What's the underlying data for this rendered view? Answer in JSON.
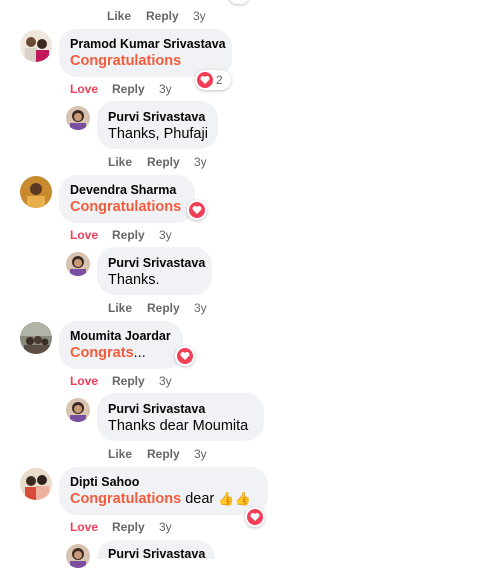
{
  "actions": {
    "like": "Like",
    "love": "Love",
    "reply": "Reply",
    "age": "3y"
  },
  "comments": [
    {
      "author": "Pramod Kumar Srivastava",
      "text": "Congratulations",
      "reaction": "heart",
      "reaction_count": "2",
      "reply": {
        "author": "Purvi Srivastava",
        "text": "Thanks, Phufaji"
      }
    },
    {
      "author": "Devendra Sharma",
      "text": "Congratulations",
      "reaction": "heart",
      "reply": {
        "author": "Purvi Srivastava",
        "text": "Thanks."
      }
    },
    {
      "author": "Moumita Joardar",
      "text": "Congrats",
      "text_suffix": "...",
      "reaction": "heart",
      "reply": {
        "author": "Purvi Srivastava",
        "text": "Thanks dear Moumita"
      }
    },
    {
      "author": "Dipti Sahoo",
      "text": "Congratulations",
      "text_suffix": " dear ",
      "emoji": "👍👍",
      "reaction": "heart",
      "reply": {
        "author": "Purvi Srivastava"
      }
    }
  ],
  "colors": {
    "congrats_text": "#f25c3c",
    "love_active": "#f33e58",
    "bubble_bg": "#f0f2f5",
    "meta_text": "#65676b"
  }
}
